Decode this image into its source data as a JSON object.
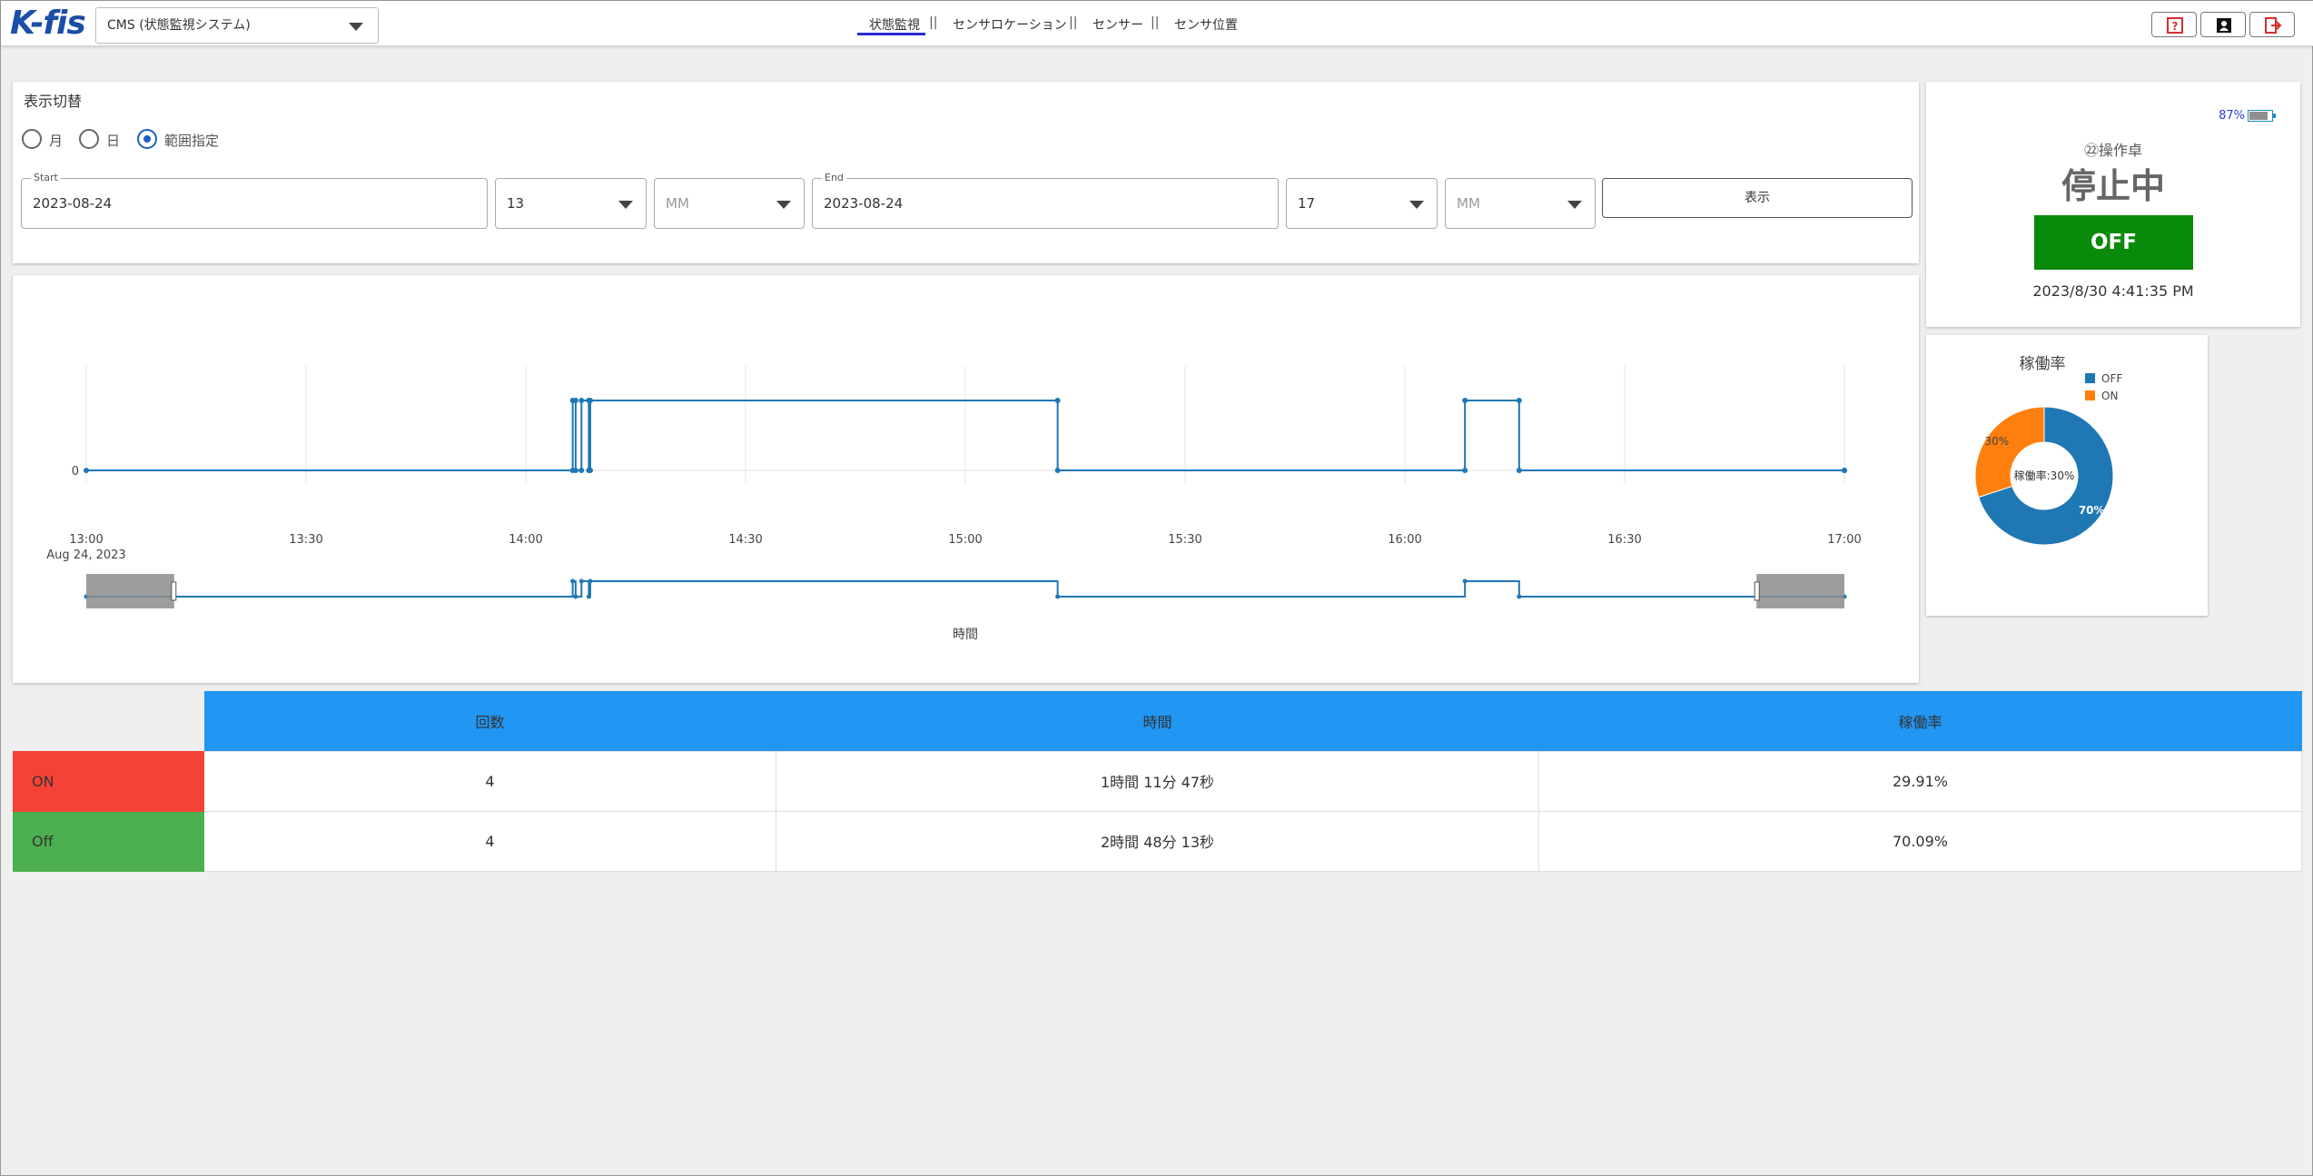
{
  "app": {
    "logo": "K-fis",
    "system_select": "CMS (状態監視システム)"
  },
  "nav": {
    "tabs": [
      "状態監視",
      "センサロケーション",
      "センサー",
      "センサ位置"
    ],
    "separator": "||",
    "active_index": 0
  },
  "header_icons": [
    "help-icon",
    "user-icon",
    "logout-icon"
  ],
  "display_switch": {
    "title": "表示切替",
    "options": [
      "月",
      "日",
      "範囲指定"
    ],
    "selected": "範囲指定",
    "start_label": "Start",
    "start_date": "2023-08-24",
    "start_hour": "13",
    "start_minute_placeholder": "MM",
    "end_label": "End",
    "end_date": "2023-08-24",
    "end_hour": "17",
    "end_minute_placeholder": "MM",
    "show_button": "表示"
  },
  "status": {
    "battery": "87%",
    "operator": "㉒操作卓",
    "state": "停止中",
    "button": "OFF",
    "timestamp": "2023/8/30 4:41:35 PM"
  },
  "chart_data": [
    {
      "type": "line",
      "title": "",
      "xlabel": "時間",
      "ylabel": "",
      "x_ticks": [
        "13:00",
        "13:30",
        "14:00",
        "14:30",
        "15:00",
        "15:30",
        "16:00",
        "16:30",
        "17:00"
      ],
      "x_date_label": "Aug 24, 2023",
      "y_ticks": [
        "0"
      ],
      "xlim": [
        "13:00",
        "17:00"
      ],
      "grid": true,
      "series": [
        {
          "step": "post",
          "color": "#1f77b4",
          "points": [
            [
              "13:00:00",
              0
            ],
            [
              "14:06:24",
              1
            ],
            [
              "14:06:48",
              0
            ],
            [
              "14:07:36",
              1
            ],
            [
              "14:08:36",
              0
            ],
            [
              "14:08:48",
              1
            ],
            [
              "15:12:36",
              0
            ],
            [
              "16:08:12",
              1
            ],
            [
              "16:15:36",
              0
            ],
            [
              "17:00:00",
              0
            ]
          ]
        }
      ],
      "range_slider": {
        "from": "13:12",
        "to": "16:48"
      }
    },
    {
      "type": "pie",
      "title": "稼働率",
      "labels": [
        "OFF",
        "ON"
      ],
      "values": [
        70,
        30
      ],
      "value_labels": [
        "70%",
        "30%"
      ],
      "colors": [
        "#1f77b4",
        "#ff7f0e"
      ],
      "center_text": "稼働率:30%",
      "legend": "top-right"
    }
  ],
  "summary": {
    "headers": [
      "回数",
      "時間",
      "稼働率"
    ],
    "rows": [
      {
        "label": "ON",
        "count": "4",
        "time": "1時間 11分 47秒",
        "rate": "29.91%"
      },
      {
        "label": "Off",
        "count": "4",
        "time": "2時間 48分 13秒",
        "rate": "70.09%"
      }
    ]
  }
}
